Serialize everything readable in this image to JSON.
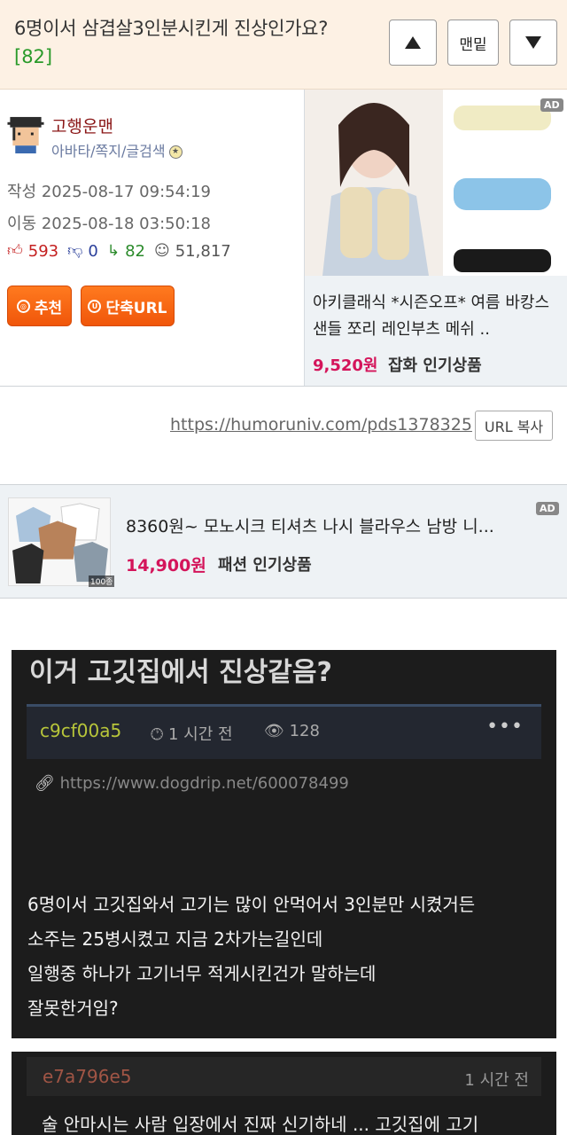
{
  "header": {
    "title": "6명이서 삼겹살3인분시킨게 진상인가요?",
    "comment_count": "[82]",
    "nav_bottom_label": "맨밑"
  },
  "author": {
    "name": "고행운맨",
    "links": "아바타/쪽지/글검색",
    "written": "작성 2025-08-17 09:54:19",
    "moved": "이동 2025-08-18 03:50:18",
    "upvotes": "593",
    "downvotes": "0",
    "replies": "82",
    "views": "51,817",
    "recommend_label": "추천",
    "shorturl_label": "단축URL"
  },
  "ad1": {
    "badge": "AD",
    "title": "아키클래식 *시즌오프* 여름 바캉스 샌들 쪼리 레인부츠 메쉬 ..",
    "price": "9,520원",
    "category": "잡화 인기상품"
  },
  "url_row": {
    "url": "https://humoruniv.com/pds1378325",
    "copy_label": "URL 복사"
  },
  "ad2": {
    "badge": "AD",
    "title": "8360원~ 모노시크 티셔츠 나시 블라우스 남방 니...",
    "price": "14,900원",
    "category": "패션 인기상품",
    "thumb_tag": "100종"
  },
  "embedded_post": {
    "title": "이거 고깃집에서 진상같음?",
    "author": "c9cf00a5",
    "time": "1 시간 전",
    "views": "128",
    "more": "•••",
    "source_url": "https://www.dogdrip.net/600078499",
    "body_lines": [
      "6명이서 고깃집와서 고기는 많이 안먹어서 3인분만 시켰거든",
      "소주는 25병시켰고 지금 2차가는길인데",
      "일행중 하나가 고기너무 적게시킨건가 말하는데",
      "잘못한거임?"
    ]
  },
  "comment": {
    "author": "e7a796e5",
    "time": "1 시간 전",
    "text": "술 안마시는 사람 입장에서 진짜 신기하네 ... 고깃집에 고기"
  },
  "colors": {
    "header_bg": "#fdf1e4",
    "accent_orange": "#f0560a",
    "price_pink": "#d4145a",
    "dark_bg": "#1c1c1c"
  }
}
